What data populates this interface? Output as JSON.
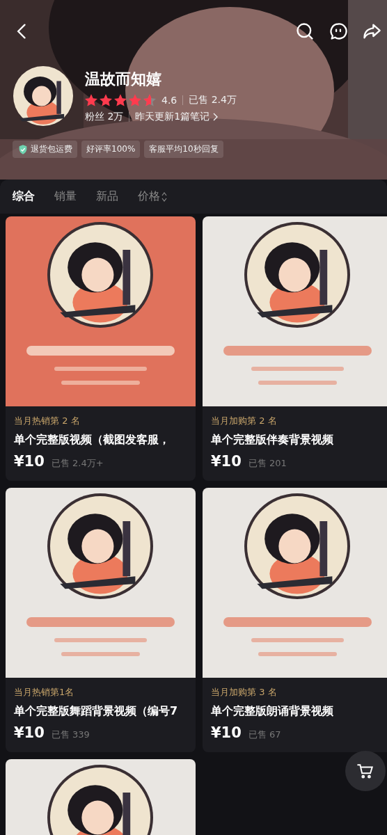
{
  "shop": {
    "name": "温故而知嬉",
    "stars": 4.6,
    "rating": "4.6",
    "sold": "已售 2.4万",
    "fans": "粉丝 2万",
    "update": "昨天更新1篇笔记",
    "badges": [
      {
        "label": "退货包运费",
        "verified": true
      },
      {
        "label": "好评率100%",
        "verified": false
      },
      {
        "label": "客服平均10秒回复",
        "verified": false
      }
    ]
  },
  "sort_tabs": [
    {
      "label": "综合",
      "selected": true,
      "sortable": false
    },
    {
      "label": "销量",
      "selected": false,
      "sortable": false
    },
    {
      "label": "新品",
      "selected": false,
      "sortable": false
    },
    {
      "label": "价格",
      "selected": false,
      "sortable": true
    }
  ],
  "products": [
    {
      "kind": "product",
      "rank": "当月热销第 2 名",
      "title": "单个完整版视频（截图发客服，",
      "price": "¥10",
      "sold": "已售 2.4万+"
    },
    {
      "kind": "product",
      "rank": "当月加购第 2 名",
      "title": "单个完整版伴奏背景视频",
      "price": "¥10",
      "sold": "已售 201"
    },
    {
      "kind": "product",
      "rank": "当月热销第1名",
      "title": "单个完整版舞蹈背景视频（编号7",
      "price": "¥10",
      "sold": "已售 339"
    },
    {
      "kind": "product",
      "rank": "当月加购第 3 名",
      "title": "单个完整版朗诵背景视频",
      "price": "¥10",
      "sold": "已售 67"
    },
    {
      "kind": "picture"
    }
  ]
}
